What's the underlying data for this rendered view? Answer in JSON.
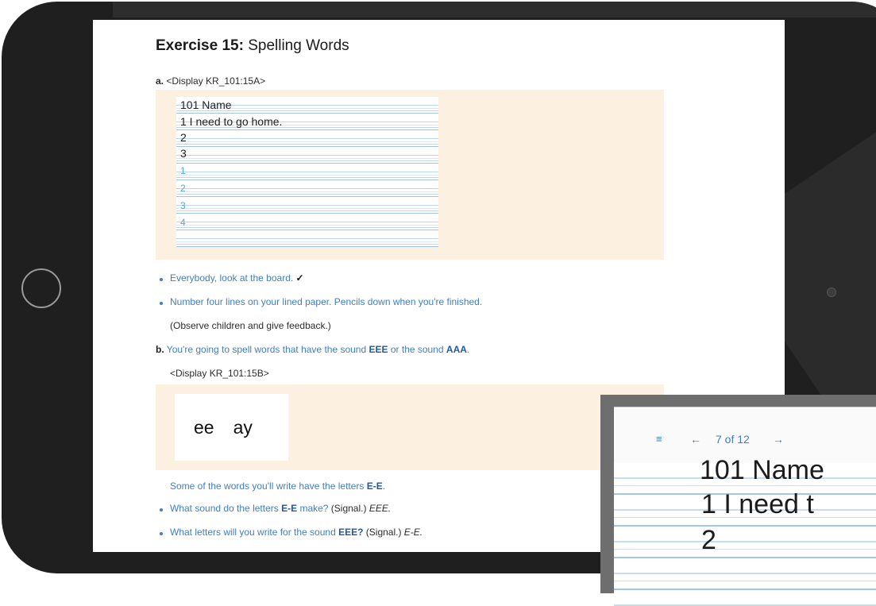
{
  "exercise": {
    "title_bold": "Exercise 15:",
    "title_rest": " Spelling Words"
  },
  "step_a": {
    "letter": "a.",
    "display_label": "<Display KR_101:15A>"
  },
  "worksheet": {
    "header": "101  Name",
    "rows": [
      "1  I need to go home.",
      "2",
      "3"
    ],
    "blue_rows": [
      "1",
      "2",
      "3",
      "4"
    ]
  },
  "instructions_a": [
    {
      "text": "Everybody, look at the board.",
      "mark": "✓"
    },
    {
      "text": "Number four lines on your lined paper. Pencils down when you're finished."
    }
  ],
  "note_a": "(Observe children and give feedback.)",
  "step_b": {
    "letter": "b.",
    "text_pre": "You're going to spell words that have the sound ",
    "sound1": "EEE",
    "text_mid": " or the sound ",
    "sound2": "AAA",
    "text_end": ".",
    "display_label": "<Display KR_101:15B>"
  },
  "letter_card": {
    "left": "ee",
    "right": "ay"
  },
  "instructions_b": {
    "line1_pre": "Some of the words you'll write have the letters ",
    "line1_bold": "E-E",
    "line1_end": ".",
    "q1_pre": "What sound do the letters ",
    "q1_bold": "E-E",
    "q1_mid": " make? ",
    "q1_signal": "(Signal.)",
    "q1_answer": " EEE.",
    "q2_pre": "What letters will you write for the sound ",
    "q2_bold": "EEE?",
    "q2_signal": " (Signal.)",
    "q2_answer": " E-E."
  },
  "overlay": {
    "menu_icon": "menu-icon",
    "prev_icon": "←",
    "page_indicator": "7 of 12",
    "next_icon": "→",
    "zoom_row1": "101 Name",
    "zoom_row2": "1 I need t",
    "zoom_row3": "2"
  },
  "colors": {
    "accent_blue": "#3f7fc0",
    "dark_blue": "#2457a3",
    "panel": "#fcf1e0",
    "bezel": "#1f1f1f"
  }
}
